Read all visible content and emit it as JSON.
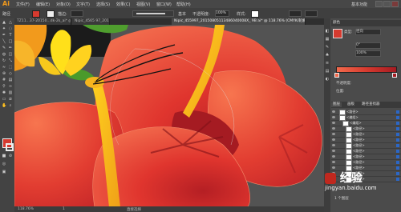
{
  "app": {
    "logo": "Ai"
  },
  "menubar": {
    "items": [
      "文件(F)",
      "编辑(E)",
      "对象(O)",
      "文字(T)",
      "选择(S)",
      "效果(C)",
      "视图(V)",
      "窗口(W)",
      "帮助(H)"
    ],
    "workspace": "基本功能"
  },
  "ctrlbar": {
    "stroke_label": "描边:",
    "opacity_label": "不透明度:",
    "opacity_value": "100%",
    "style_label": "样式:",
    "basic_label": "基本",
    "fill_color": "#d63a2f"
  },
  "tabs": {
    "items": [
      {
        "label": "TZ11...37-20150...dk-2k_ai* @ 100%...",
        "active": false
      },
      {
        "label": "Nipic_4565 97_2015... @ 3 %...",
        "active": false
      },
      {
        "label": "Nipic_455997_20150805113486040008X_ 9B ai* @ 118.76% (CMYK/轮廓)",
        "active": true
      }
    ]
  },
  "statusbar": {
    "zoom": "118.76%",
    "page": "1",
    "tool": "直接选择"
  },
  "panel": {
    "color_tab": "颜色",
    "type_label": "类型:",
    "type_value": "径向",
    "angle_value": "0°",
    "ratio_value": "100%",
    "opacity_label": "不透明度:",
    "position_label": "位置:",
    "layers_tabs": [
      "图层",
      "画板",
      "路径查找器"
    ],
    "layers": [
      {
        "name": "<路径>",
        "level": 0
      },
      {
        "name": "<编组>",
        "level": 0
      },
      {
        "name": "<编组>",
        "level": 1
      },
      {
        "name": "<路径>",
        "level": 2
      },
      {
        "name": "<路径>",
        "level": 2
      },
      {
        "name": "<路径>",
        "level": 2
      },
      {
        "name": "<路径>",
        "level": 2
      },
      {
        "name": "<路径>",
        "level": 2
      },
      {
        "name": "<路径>",
        "level": 2
      },
      {
        "name": "<路径>",
        "level": 2
      },
      {
        "name": "<路径>",
        "level": 2
      },
      {
        "name": "<路径>",
        "level": 2
      },
      {
        "name": "<路径>",
        "level": 2
      }
    ],
    "layer_count": "1 个图层"
  },
  "watermark": {
    "brand": "Baidu",
    "brand_cn": "经验",
    "url": "jingyan.baidu.com"
  },
  "icons": {
    "tool_selection": "arrow-icon",
    "tool_direct": "direct-select-icon",
    "eye": "eye-icon"
  }
}
